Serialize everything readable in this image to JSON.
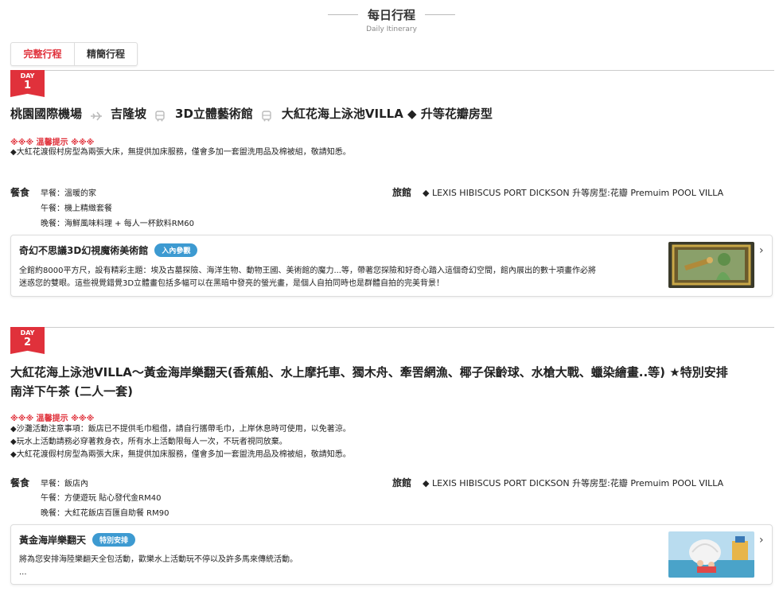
{
  "header": {
    "title": "每日行程",
    "subtitle": "Daily Itinerary"
  },
  "tabs": [
    {
      "label": "完整行程",
      "active": true
    },
    {
      "label": "精簡行程",
      "active": false
    }
  ],
  "days": [
    {
      "badge_label": "DAY",
      "badge_number": "1",
      "route_stops": [
        "桃園國際機場",
        "吉隆坡",
        "3D立體藝術館",
        "大紅花海上泳池VILLA ◆ 升等花瓣房型"
      ],
      "route_separators": [
        "plane-icon",
        "bus-icon",
        "bus-icon"
      ],
      "notice_title": "※※※ 溫馨提示 ※※※",
      "notices": [
        "◆大紅花渡假村房型為兩張大床，無提供加床服務，僅會多加一套盥洗用品及棉被組，敬請知悉。"
      ],
      "meals_label": "餐食",
      "meals": [
        "早餐：溫暖的家",
        "午餐：機上精緻套餐",
        "晚餐：海鮮風味料理 + 每人一杯飲料RM60"
      ],
      "hotel_label": "旅館",
      "hotel": "◆ LEXIS HIBISCUS PORT DICKSON 升等房型:花瓣 Premuim POOL VILLA",
      "card": {
        "title": "奇幻不思議3D幻視魔術美術館",
        "tag": "入內參觀",
        "desc": [
          "全館約8000平方尺，設有精彩主題：埃及古墓探險、海洋生物、動物王國、美術館的魔力...等，帶著您探險和好奇心踏入這個奇幻空間，館內展出的數十項畫作必將",
          "迷惑您的雙眼。這些視覺錯覺3D立體畫包括多幅可以在黑暗中發亮的螢光畫，是個人自拍同時也是群體自拍的完美背景！"
        ]
      }
    },
    {
      "badge_label": "DAY",
      "badge_number": "2",
      "route_text": [
        "大紅花海上泳池VILLA～黃金海岸樂翻天(香蕉船、水上摩托車、獨木舟、牽罟網漁、椰子保齡球、水槍大戰、蠟染繪畫..等) ★特別安排",
        "南洋下午茶 (二人一套)"
      ],
      "notice_title": "※※※ 溫馨提示 ※※※",
      "notices": [
        "◆沙灘活動注意事項：飯店已不提供毛巾租借，請自行攜帶毛巾，上岸休息時可使用，以免著涼。",
        "◆玩水上活動請務必穿著救身衣，所有水上活動限每人一次，不玩者視同放棄。",
        "◆大紅花渡假村房型為兩張大床，無提供加床服務，僅會多加一套盥洗用品及棉被組，敬請知悉。"
      ],
      "meals_label": "餐食",
      "meals": [
        "早餐：飯店內",
        "午餐：方便遊玩 貼心發代金RM40",
        "晚餐：大紅花飯店百匯自助餐 RM90"
      ],
      "hotel_label": "旅館",
      "hotel": "◆ LEXIS HIBISCUS PORT DICKSON 升等房型:花瓣 Premuim POOL VILLA",
      "card": {
        "title": "黃金海岸樂翻天",
        "tag": "特別安排",
        "desc": [
          "將為您安排海陸樂翻天全包活動，歡樂水上活動玩不停以及許多馬來傳統活動。",
          "..."
        ]
      }
    }
  ],
  "colors": {
    "accent_red": "#e0313b",
    "tag_blue": "#3d9ad1"
  },
  "icons": {
    "card_more": "chevron-right-icon"
  }
}
